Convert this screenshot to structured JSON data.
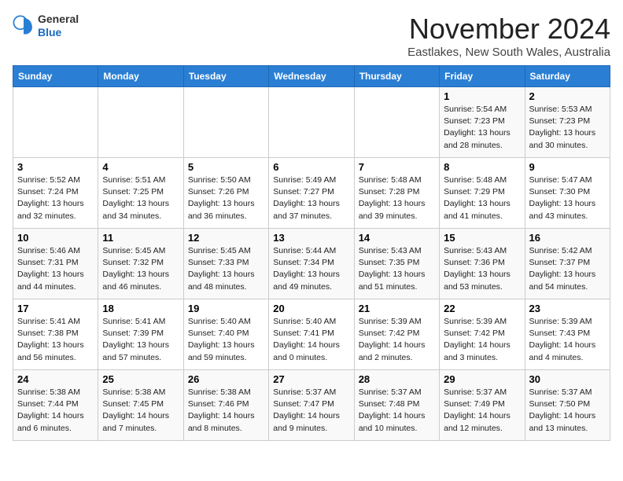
{
  "logo": {
    "general": "General",
    "blue": "Blue"
  },
  "title": "November 2024",
  "location": "Eastlakes, New South Wales, Australia",
  "days_header": [
    "Sunday",
    "Monday",
    "Tuesday",
    "Wednesday",
    "Thursday",
    "Friday",
    "Saturday"
  ],
  "weeks": [
    [
      {
        "day": "",
        "info": ""
      },
      {
        "day": "",
        "info": ""
      },
      {
        "day": "",
        "info": ""
      },
      {
        "day": "",
        "info": ""
      },
      {
        "day": "",
        "info": ""
      },
      {
        "day": "1",
        "info": "Sunrise: 5:54 AM\nSunset: 7:23 PM\nDaylight: 13 hours\nand 28 minutes."
      },
      {
        "day": "2",
        "info": "Sunrise: 5:53 AM\nSunset: 7:23 PM\nDaylight: 13 hours\nand 30 minutes."
      }
    ],
    [
      {
        "day": "3",
        "info": "Sunrise: 5:52 AM\nSunset: 7:24 PM\nDaylight: 13 hours\nand 32 minutes."
      },
      {
        "day": "4",
        "info": "Sunrise: 5:51 AM\nSunset: 7:25 PM\nDaylight: 13 hours\nand 34 minutes."
      },
      {
        "day": "5",
        "info": "Sunrise: 5:50 AM\nSunset: 7:26 PM\nDaylight: 13 hours\nand 36 minutes."
      },
      {
        "day": "6",
        "info": "Sunrise: 5:49 AM\nSunset: 7:27 PM\nDaylight: 13 hours\nand 37 minutes."
      },
      {
        "day": "7",
        "info": "Sunrise: 5:48 AM\nSunset: 7:28 PM\nDaylight: 13 hours\nand 39 minutes."
      },
      {
        "day": "8",
        "info": "Sunrise: 5:48 AM\nSunset: 7:29 PM\nDaylight: 13 hours\nand 41 minutes."
      },
      {
        "day": "9",
        "info": "Sunrise: 5:47 AM\nSunset: 7:30 PM\nDaylight: 13 hours\nand 43 minutes."
      }
    ],
    [
      {
        "day": "10",
        "info": "Sunrise: 5:46 AM\nSunset: 7:31 PM\nDaylight: 13 hours\nand 44 minutes."
      },
      {
        "day": "11",
        "info": "Sunrise: 5:45 AM\nSunset: 7:32 PM\nDaylight: 13 hours\nand 46 minutes."
      },
      {
        "day": "12",
        "info": "Sunrise: 5:45 AM\nSunset: 7:33 PM\nDaylight: 13 hours\nand 48 minutes."
      },
      {
        "day": "13",
        "info": "Sunrise: 5:44 AM\nSunset: 7:34 PM\nDaylight: 13 hours\nand 49 minutes."
      },
      {
        "day": "14",
        "info": "Sunrise: 5:43 AM\nSunset: 7:35 PM\nDaylight: 13 hours\nand 51 minutes."
      },
      {
        "day": "15",
        "info": "Sunrise: 5:43 AM\nSunset: 7:36 PM\nDaylight: 13 hours\nand 53 minutes."
      },
      {
        "day": "16",
        "info": "Sunrise: 5:42 AM\nSunset: 7:37 PM\nDaylight: 13 hours\nand 54 minutes."
      }
    ],
    [
      {
        "day": "17",
        "info": "Sunrise: 5:41 AM\nSunset: 7:38 PM\nDaylight: 13 hours\nand 56 minutes."
      },
      {
        "day": "18",
        "info": "Sunrise: 5:41 AM\nSunset: 7:39 PM\nDaylight: 13 hours\nand 57 minutes."
      },
      {
        "day": "19",
        "info": "Sunrise: 5:40 AM\nSunset: 7:40 PM\nDaylight: 13 hours\nand 59 minutes."
      },
      {
        "day": "20",
        "info": "Sunrise: 5:40 AM\nSunset: 7:41 PM\nDaylight: 14 hours\nand 0 minutes."
      },
      {
        "day": "21",
        "info": "Sunrise: 5:39 AM\nSunset: 7:42 PM\nDaylight: 14 hours\nand 2 minutes."
      },
      {
        "day": "22",
        "info": "Sunrise: 5:39 AM\nSunset: 7:42 PM\nDaylight: 14 hours\nand 3 minutes."
      },
      {
        "day": "23",
        "info": "Sunrise: 5:39 AM\nSunset: 7:43 PM\nDaylight: 14 hours\nand 4 minutes."
      }
    ],
    [
      {
        "day": "24",
        "info": "Sunrise: 5:38 AM\nSunset: 7:44 PM\nDaylight: 14 hours\nand 6 minutes."
      },
      {
        "day": "25",
        "info": "Sunrise: 5:38 AM\nSunset: 7:45 PM\nDaylight: 14 hours\nand 7 minutes."
      },
      {
        "day": "26",
        "info": "Sunrise: 5:38 AM\nSunset: 7:46 PM\nDaylight: 14 hours\nand 8 minutes."
      },
      {
        "day": "27",
        "info": "Sunrise: 5:37 AM\nSunset: 7:47 PM\nDaylight: 14 hours\nand 9 minutes."
      },
      {
        "day": "28",
        "info": "Sunrise: 5:37 AM\nSunset: 7:48 PM\nDaylight: 14 hours\nand 10 minutes."
      },
      {
        "day": "29",
        "info": "Sunrise: 5:37 AM\nSunset: 7:49 PM\nDaylight: 14 hours\nand 12 minutes."
      },
      {
        "day": "30",
        "info": "Sunrise: 5:37 AM\nSunset: 7:50 PM\nDaylight: 14 hours\nand 13 minutes."
      }
    ]
  ]
}
